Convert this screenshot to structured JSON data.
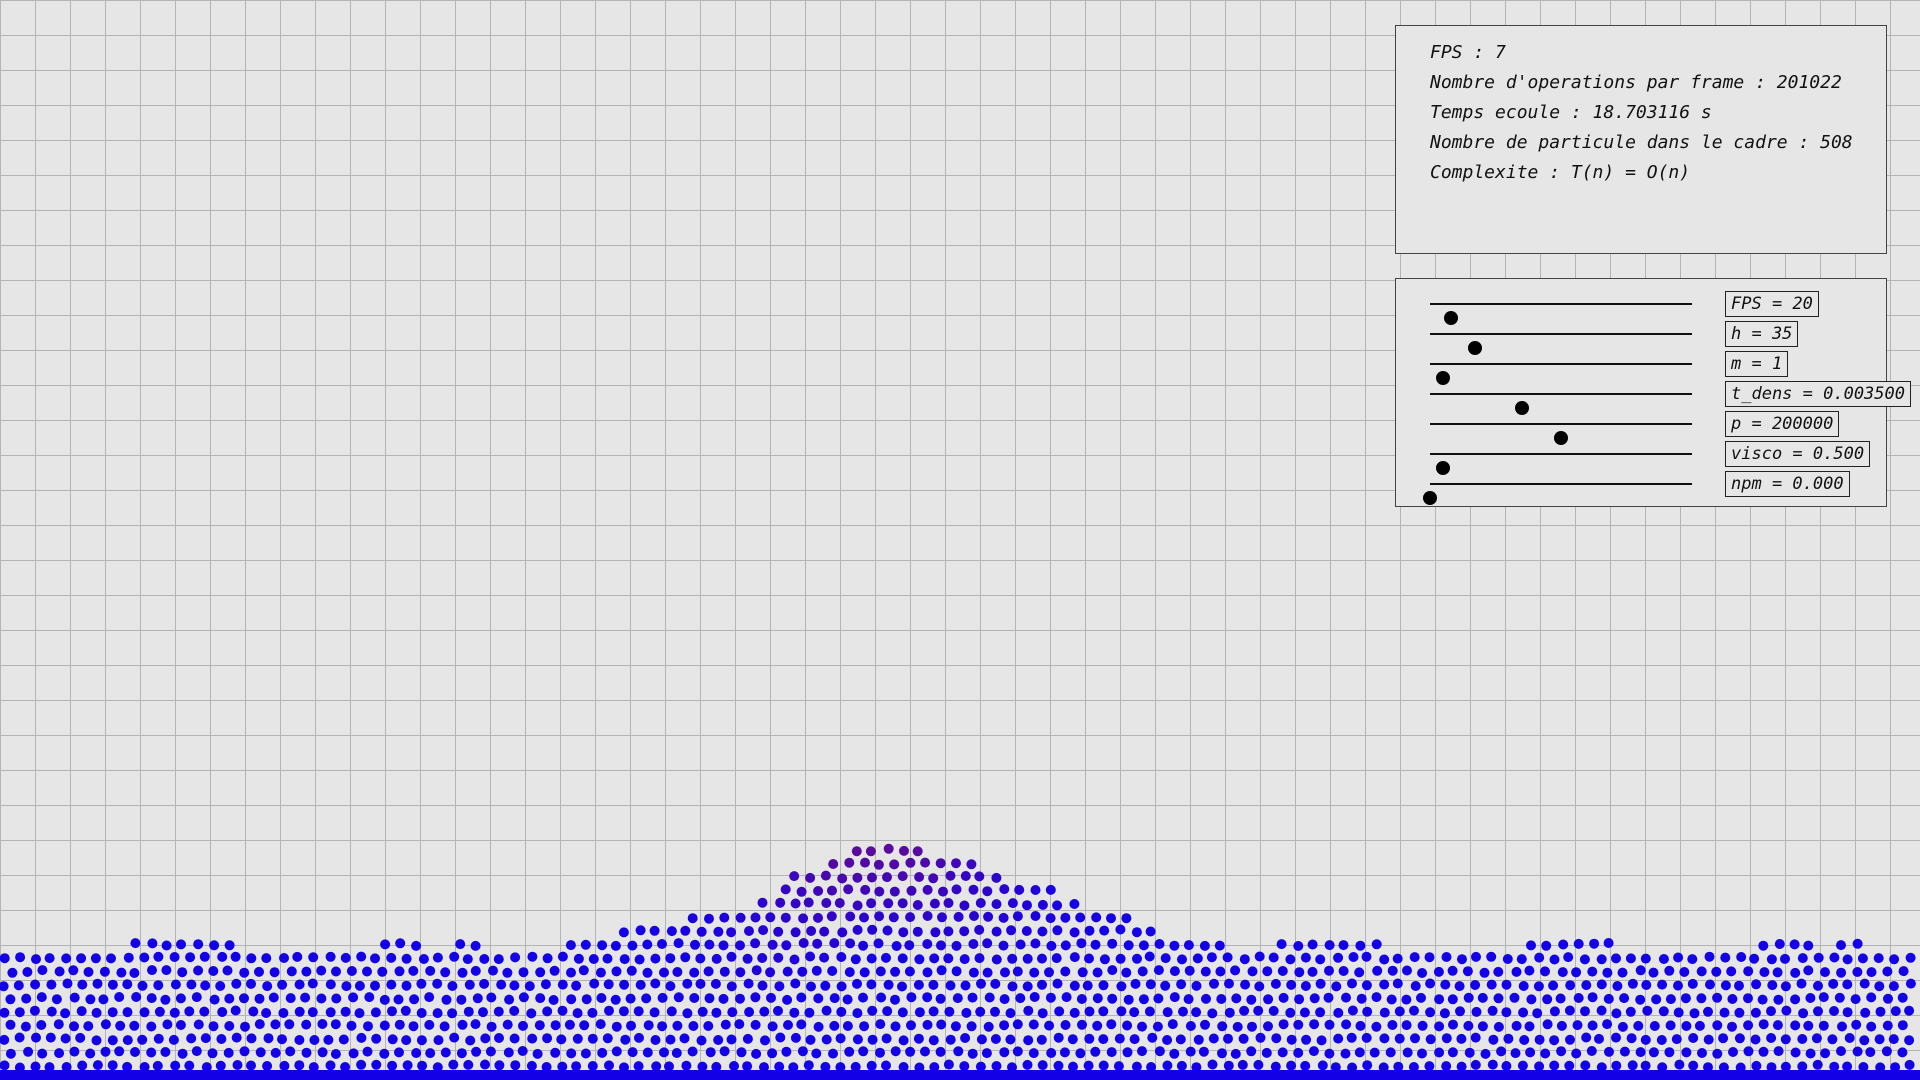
{
  "stats": {
    "fps": "FPS : 7",
    "operations": "Nombre d'operations par frame : 201022",
    "elapsed": "Temps ecoule : 18.703116 s",
    "particle_count": "Nombre de particule dans le cadre : 508",
    "complexity": "Complexite : T(n) = O(n)"
  },
  "controls": [
    {
      "label": "FPS = 20",
      "level": 0.08
    },
    {
      "label": "h = 35",
      "level": 0.17
    },
    {
      "label": "m = 1",
      "level": 0.05
    },
    {
      "label": "t_dens = 0.003500",
      "level": 0.35
    },
    {
      "label": "p = 200000",
      "level": 0.5
    },
    {
      "label": "visco = 0.500",
      "level": 0.05
    },
    {
      "label": "npm = 0.000",
      "level": 0.0
    }
  ],
  "colors": {
    "background": "#e6e6e6",
    "grid": "#b4b4b4",
    "particle_low_density": "#1400e6",
    "particle_high_density": "#5a0a9c"
  }
}
